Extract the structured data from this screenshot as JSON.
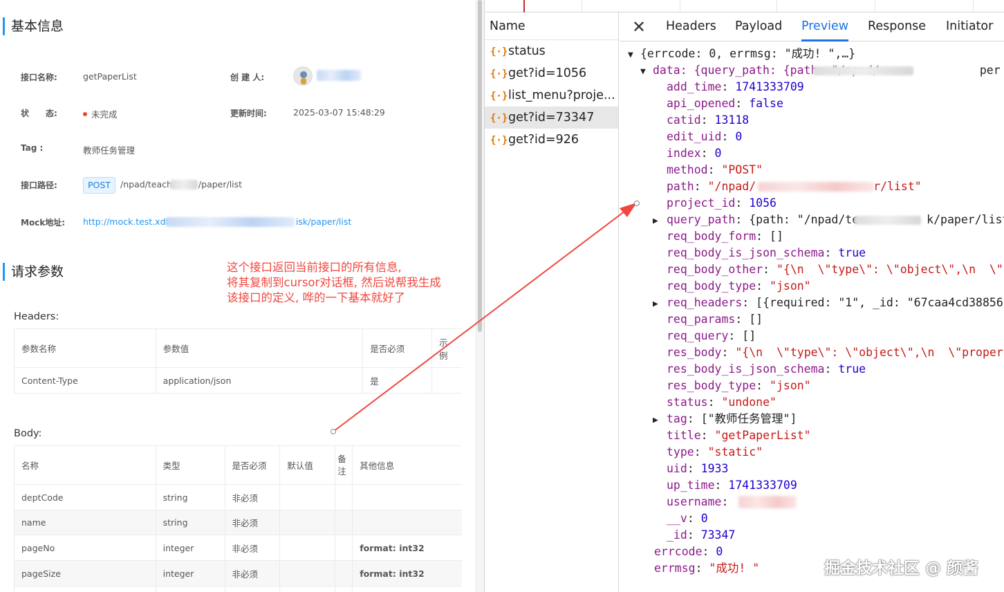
{
  "left": {
    "basic_info_title": "基本信息",
    "fields": {
      "api_name_label": "接口名称:",
      "api_name_value": "getPaperList",
      "creator_label": "创 建 人:",
      "status_label": "状　　态:",
      "status_value": "未完成",
      "update_time_label": "更新时间:",
      "update_time_value": "2025-03-07 15:48:29",
      "tag_label": "Tag :",
      "tag_value": "教师任务管理",
      "path_label": "接口路径:",
      "method": "POST",
      "path_prefix": "/npad/teach",
      "path_suffix": "/paper/list",
      "mock_label": "Mock地址:",
      "mock_prefix": "http://mock.test.xdf",
      "mock_suffix": "isk/paper/list"
    },
    "request_params_title": "请求参数",
    "annotation": [
      "这个接口返回当前接口的所有信息,",
      "将其复制到cursor对话框, 然后说帮我生成",
      "该接口的定义, 哗的一下基本就好了"
    ],
    "headers_label": "Headers:",
    "headers_table": {
      "columns": [
        "参数名称",
        "参数值",
        "是否必须",
        "示例"
      ],
      "rows": [
        [
          "Content-Type",
          "application/json",
          "是",
          ""
        ]
      ]
    },
    "body_label": "Body:",
    "body_table": {
      "columns": [
        "名称",
        "类型",
        "是否必须",
        "默认值",
        "备注",
        "其他信息"
      ],
      "rows": [
        [
          "deptCode",
          "string",
          "非必须",
          "",
          "",
          ""
        ],
        [
          "name",
          "string",
          "非必须",
          "",
          "",
          ""
        ],
        [
          "pageNo",
          "integer",
          "非必须",
          "",
          "",
          "format: int32"
        ],
        [
          "pageSize",
          "integer",
          "非必须",
          "",
          "",
          "format: int32"
        ]
      ]
    }
  },
  "devtools": {
    "requests_header": "Name",
    "requests": [
      "status",
      "get?id=1056",
      "list_menu?proje...",
      "get?id=73347",
      "get?id=926"
    ],
    "selected_request": "get?id=73347",
    "tabs": [
      "Headers",
      "Payload",
      "Preview",
      "Response",
      "Initiator"
    ],
    "active_tab": "Preview",
    "json": {
      "root": "{errcode: 0, errmsg: \"成功! \",…}",
      "data": "data: {query_path: {path: \"/npad/",
      "data_tail": "per",
      "add_time": "1741333709",
      "api_opened": "false",
      "catid": "13118",
      "edit_uid": "0",
      "index": "0",
      "method": "\"POST\"",
      "path_prefix": "\"/npad/",
      "path_suffix": "r/list\"",
      "project_id": "1056",
      "query_path_prefix": "{path: \"/npad/te",
      "query_path_suffix": "k/paper/list\"",
      "req_body_form": "[]",
      "req_body_is_json_schema": "true",
      "req_body_other": "\"{\\n  \\\"type\\\": \\\"object\\\",\\n  \\\"",
      "req_body_type": "\"json\"",
      "req_headers": "[{required: \"1\", _id: \"67caa4cd38856",
      "req_params": "[]",
      "req_query": "[]",
      "res_body": "\"{\\n  \\\"type\\\": \\\"object\\\",\\n  \\\"proper",
      "res_body_is_json_schema": "true",
      "res_body_type": "\"json\"",
      "status": "\"undone\"",
      "tag": "[\"教师任务管理\"]",
      "title": "\"getPaperList\"",
      "type": "\"static\"",
      "uid": "1933",
      "up_time": "1741333709",
      "username_label": "username",
      "v": "0",
      "id": "73347",
      "errcode": "0",
      "errmsg": "\"成功! \""
    }
  },
  "watermark": "掘金技术社区 @ 颜酱",
  "colors": {
    "accent": "#2395f1",
    "annotation_red": "#f0473f",
    "devtools_blue": "#1a73e8",
    "json_key": "#8b1a89",
    "json_string": "#c41a16",
    "json_number": "#1c00cf"
  }
}
